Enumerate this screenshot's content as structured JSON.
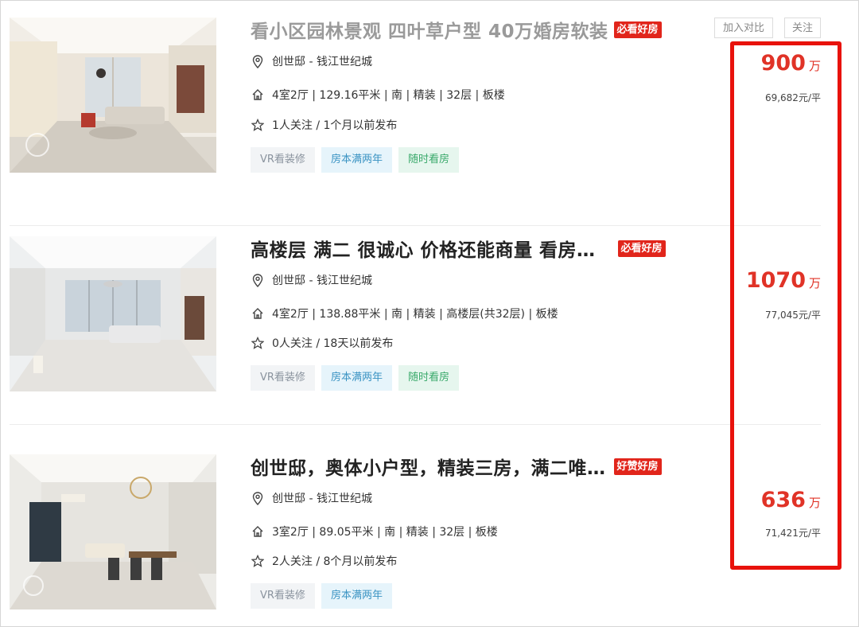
{
  "actions": {
    "compare_label": "加入对比",
    "follow_label": "关注"
  },
  "listings": [
    {
      "title": "看小区园林景观 四叶草户型 40万婚房软装",
      "badge": "必看好房",
      "location": "创世邸 - 钱江世纪城",
      "details": "4室2厅 | 129.16平米 | 南 | 精装 | 32层 | 板楼",
      "followers": "1人关注 / 1个月以前发布",
      "tags": [
        "VR看装修",
        "房本满两年",
        "随时看房"
      ],
      "total_price": "900",
      "price_unit": "万",
      "unit_price": "69,682元/平"
    },
    {
      "title": "高楼层 满二 很诚心 价格还能商量 看房…",
      "badge": "必看好房",
      "location": "创世邸 - 钱江世纪城",
      "details": "4室2厅 | 138.88平米 | 南 | 精装 | 高楼层(共32层) | 板楼",
      "followers": "0人关注 / 18天以前发布",
      "tags": [
        "VR看装修",
        "房本满两年",
        "随时看房"
      ],
      "total_price": "1070",
      "price_unit": "万",
      "unit_price": "77,045元/平"
    },
    {
      "title": "创世邸，奥体小户型，精装三房，满二唯…",
      "badge": "好赞好房",
      "location": "创世邸 - 钱江世纪城",
      "details": "3室2厅 | 89.05平米 | 南 | 精装 | 32层 | 板楼",
      "followers": "2人关注 / 8个月以前发布",
      "tags": [
        "VR看装修",
        "房本满两年"
      ],
      "total_price": "636",
      "price_unit": "万",
      "unit_price": "71,421元/平"
    }
  ],
  "colors": {
    "price": "#e03327",
    "badge": "#e1251b",
    "highlight": "#e8120c"
  }
}
